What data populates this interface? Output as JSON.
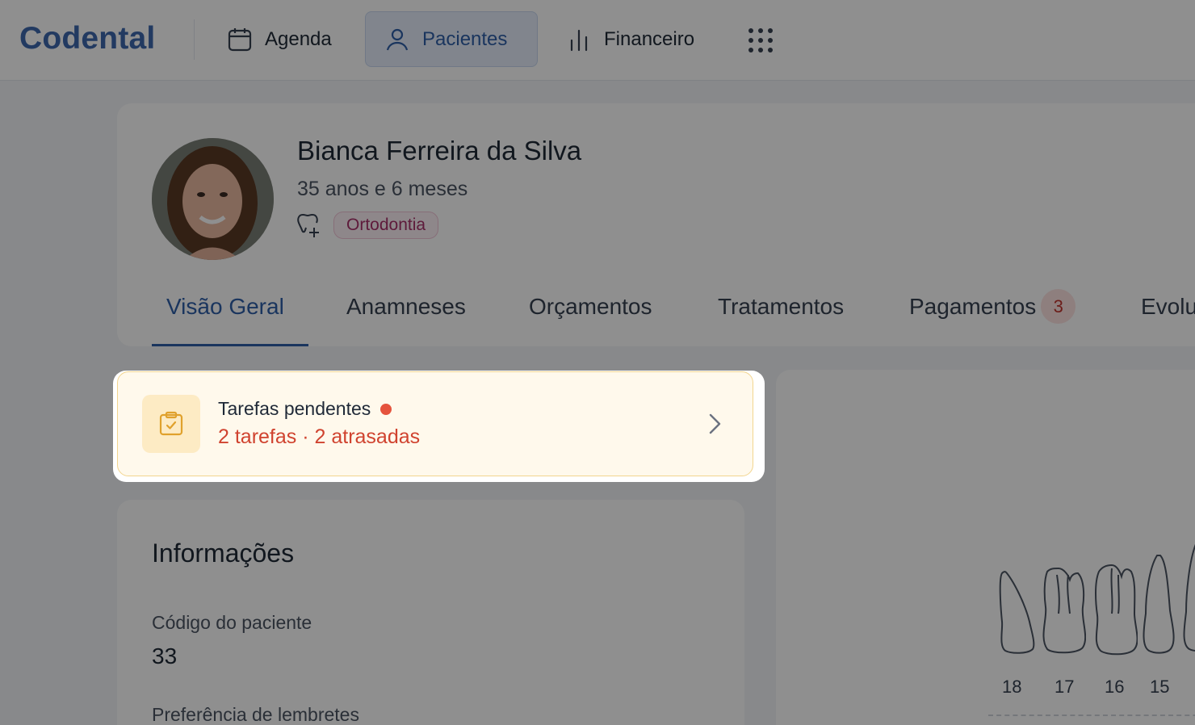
{
  "brand": {
    "name": "Codental",
    "color": "#3e68ad"
  },
  "nav": {
    "items": [
      {
        "label": "Agenda",
        "icon": "calendar-icon"
      },
      {
        "label": "Pacientes",
        "icon": "user-icon",
        "active": true
      },
      {
        "label": "Financeiro",
        "icon": "bar-chart-icon"
      }
    ],
    "apps_icon": "grid-dots-icon"
  },
  "patient": {
    "name": "Bianca Ferreira da Silva",
    "age": "35 anos e 6 meses",
    "tag": "Ortodontia"
  },
  "tabs": [
    {
      "label": "Visão Geral",
      "active": true
    },
    {
      "label": "Anamneses"
    },
    {
      "label": "Orçamentos"
    },
    {
      "label": "Tratamentos"
    },
    {
      "label": "Pagamentos",
      "badge": "3"
    },
    {
      "label": "Evolu"
    }
  ],
  "tasks": {
    "title": "Tarefas pendentes",
    "subtitle": "2 tarefas · 2 atrasadas",
    "status_color": "#e5533d"
  },
  "info": {
    "title": "Informações",
    "fields": [
      {
        "label": "Código do paciente",
        "value": "33"
      },
      {
        "label": "Preferência de lembretes",
        "value": ""
      }
    ]
  },
  "odontogram": {
    "teeth": [
      "18",
      "17",
      "16",
      "15"
    ]
  }
}
